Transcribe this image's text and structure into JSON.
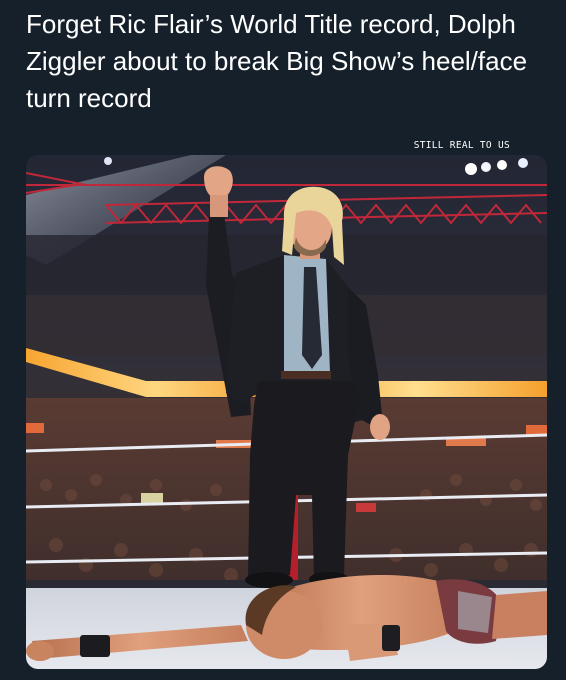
{
  "post": {
    "headline": "Forget Ric Flair’s World Title record, Dolph Ziggler about to break Big Show’s heel/face turn record",
    "credit": "STILL REAL TO US"
  },
  "photo": {
    "subject": "wrestler-standing-over-opponent",
    "colors": {
      "background": "#15202b",
      "stage_truss": "#c0283a",
      "led_ribbon": "#f0a020",
      "ring_mat": "#dadde4"
    }
  }
}
